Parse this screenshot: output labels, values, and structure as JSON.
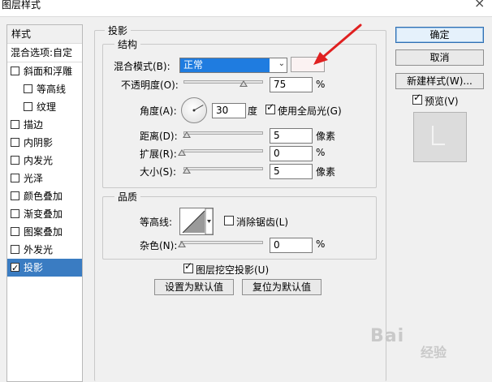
{
  "window": {
    "title": "图层样式",
    "close_glyph": "×"
  },
  "left_list": {
    "header": "样式",
    "blend_options": "混合选项:自定",
    "items": [
      {
        "label": "斜面和浮雕",
        "checked": false
      },
      {
        "label": "等高线",
        "checked": false
      },
      {
        "label": "纹理",
        "checked": false
      },
      {
        "label": "描边",
        "checked": false
      },
      {
        "label": "内阴影",
        "checked": false
      },
      {
        "label": "内发光",
        "checked": false
      },
      {
        "label": "光泽",
        "checked": false
      },
      {
        "label": "颜色叠加",
        "checked": false
      },
      {
        "label": "渐变叠加",
        "checked": false
      },
      {
        "label": "图案叠加",
        "checked": false
      },
      {
        "label": "外发光",
        "checked": false
      },
      {
        "label": "投影",
        "checked": true,
        "selected": true
      }
    ]
  },
  "drop_shadow": {
    "title": "投影",
    "structure": {
      "title": "结构",
      "blend_mode_label": "混合模式(B):",
      "blend_mode_value": "正常",
      "swatch_color": "#fbf2f2",
      "opacity_label": "不透明度(O):",
      "opacity_value": "75",
      "opacity_unit": "%",
      "opacity_fraction": 0.75,
      "angle_label": "角度(A):",
      "angle_value": "30",
      "angle_unit": "度",
      "global_light_label": "使用全局光(G)",
      "global_light_checked": true,
      "distance_label": "距离(D):",
      "distance_value": "5",
      "distance_unit": "像素",
      "spread_label": "扩展(R):",
      "spread_value": "0",
      "spread_unit": "%",
      "size_label": "大小(S):",
      "size_value": "5",
      "size_unit": "像素"
    },
    "quality": {
      "title": "品质",
      "contour_label": "等高线:",
      "anti_alias_label": "消除锯齿(L)",
      "anti_alias_checked": false,
      "noise_label": "杂色(N):",
      "noise_value": "0",
      "noise_unit": "%"
    },
    "knockout_label": "图层挖空投影(U)",
    "knockout_checked": true,
    "set_default_label": "设置为默认值",
    "reset_default_label": "复位为默认值"
  },
  "buttons": {
    "ok": "确定",
    "cancel": "取消",
    "new_style": "新建样式(W)...",
    "preview_label": "预览(V)",
    "preview_checked": true
  },
  "watermark": {
    "text": "Bai",
    "tail_text": "经验"
  },
  "colors": {
    "accent": "#1f7ce0",
    "selected_row": "#3a7cc2",
    "annotation_arrow": "#e02020"
  }
}
